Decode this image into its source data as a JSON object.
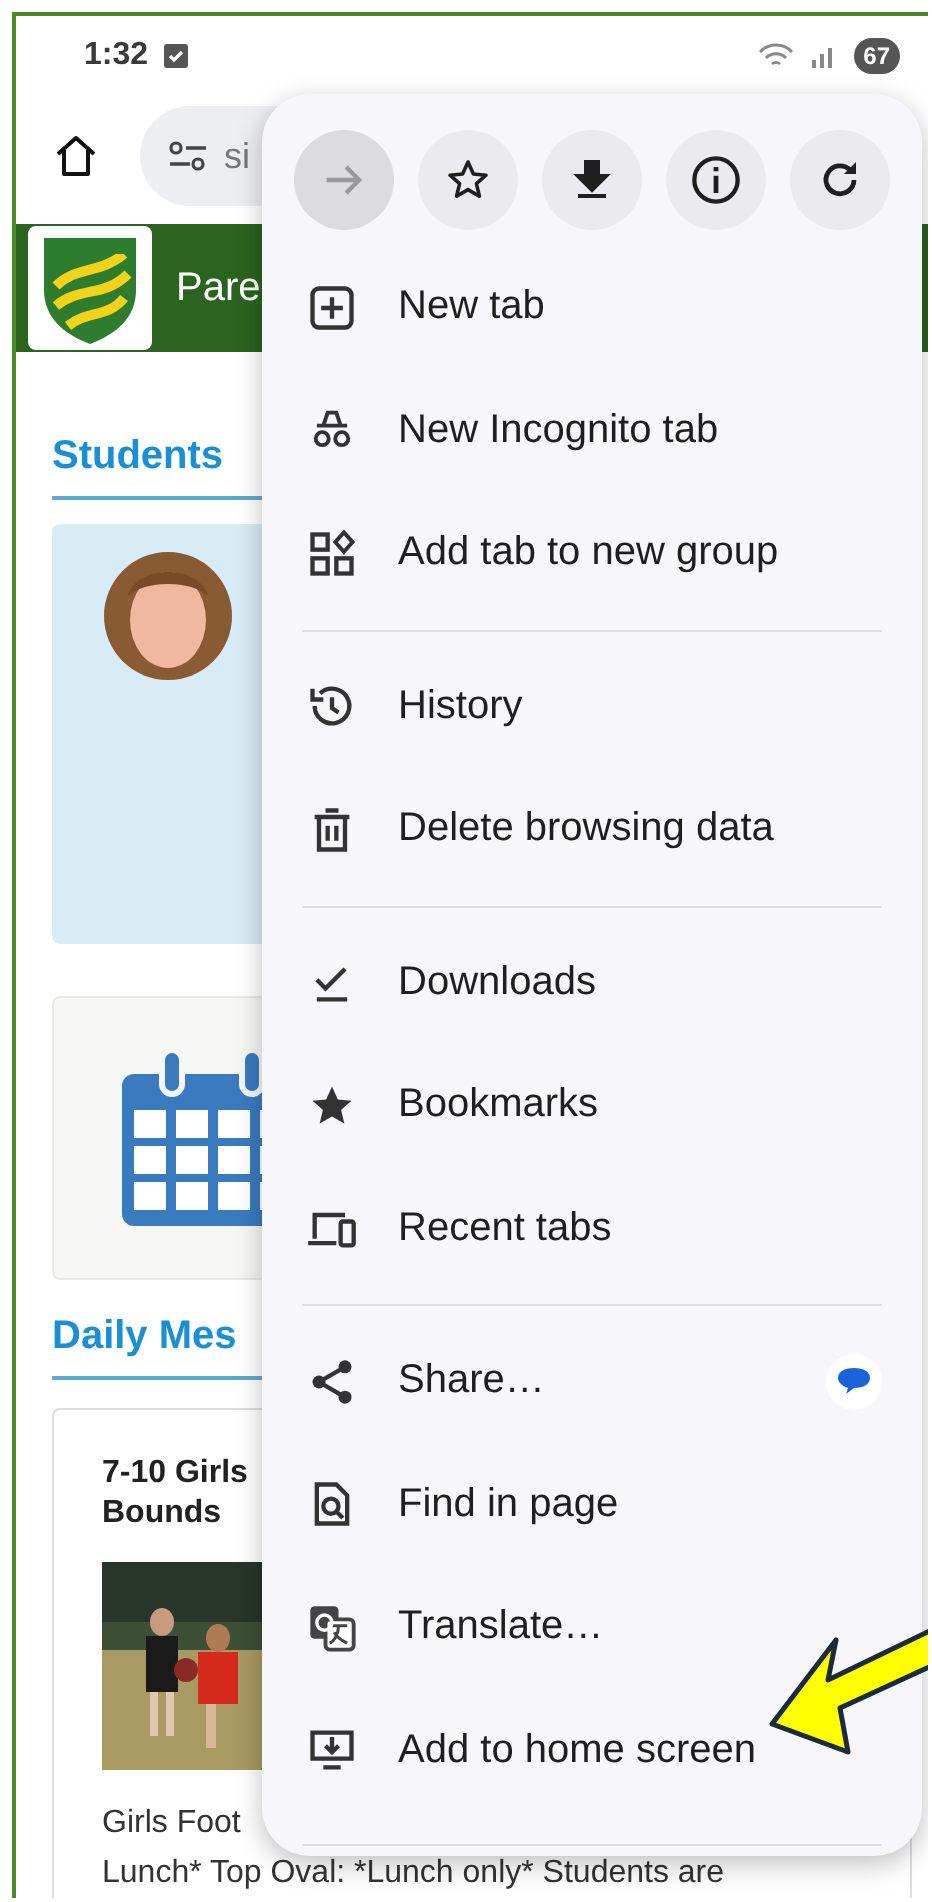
{
  "status_bar": {
    "time": "1:32",
    "battery": "67"
  },
  "toolbar": {
    "url_text": "si"
  },
  "header": {
    "title": "Pare"
  },
  "students": {
    "heading": "Students"
  },
  "daily_messages": {
    "heading": "Daily Mes",
    "card": {
      "title_lines": [
        "7-10 Girls",
        "Bounds"
      ],
      "text_lines": [
        "Girls Foot",
        "Lunch* Top Oval: *Lunch only* Students are"
      ]
    }
  },
  "menu": {
    "actions": [
      {
        "disabled": true
      },
      {
        "disabled": false
      },
      {
        "disabled": false
      },
      {
        "disabled": false
      },
      {
        "disabled": false
      }
    ],
    "sections": [
      [
        {
          "label": "New tab",
          "shortcut": false
        },
        {
          "label": "New Incognito tab",
          "shortcut": false
        },
        {
          "label": "Add tab to new group",
          "shortcut": false
        }
      ],
      [
        {
          "label": "History",
          "shortcut": false
        },
        {
          "label": "Delete browsing data",
          "shortcut": false
        }
      ],
      [
        {
          "label": "Downloads",
          "shortcut": false
        },
        {
          "label": "Bookmarks",
          "shortcut": false
        },
        {
          "label": "Recent tabs",
          "shortcut": false
        }
      ],
      [
        {
          "label": "Share…",
          "shortcut": true
        },
        {
          "label": "Find in page",
          "shortcut": false
        },
        {
          "label": "Translate…",
          "shortcut": false
        },
        {
          "label": "Add to home screen",
          "shortcut": false
        }
      ]
    ]
  }
}
